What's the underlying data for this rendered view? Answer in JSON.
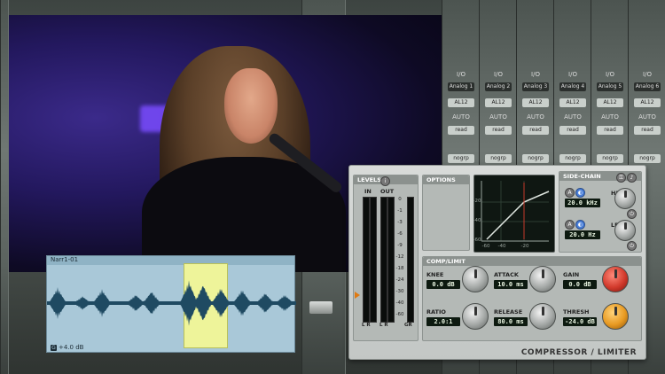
{
  "mixer": {
    "strips": [
      {
        "io": "I/O",
        "insert": "Analog 1",
        "bus": "AL12",
        "auto": "AUTO",
        "mode": "read",
        "group": "nogrp"
      },
      {
        "io": "I/O",
        "insert": "Analog 2",
        "bus": "AL12",
        "auto": "AUTO",
        "mode": "read",
        "group": "nogrp"
      },
      {
        "io": "I/O",
        "insert": "Analog 3",
        "bus": "AL12",
        "auto": "AUTO",
        "mode": "read",
        "group": "nogrp"
      },
      {
        "io": "I/O",
        "insert": "Analog 4",
        "bus": "AL12",
        "auto": "AUTO",
        "mode": "read",
        "group": "nogrp"
      },
      {
        "io": "I/O",
        "insert": "Analog 5",
        "bus": "AL12",
        "auto": "AUTO",
        "mode": "read",
        "group": "nogrp"
      },
      {
        "io": "I/O",
        "insert": "Analog 6",
        "bus": "AL12",
        "auto": "AUTO",
        "mode": "read",
        "group": "nogrp"
      }
    ]
  },
  "clip": {
    "name": "Narr1-01",
    "gain": "+4.0 dB",
    "gain_icon": "G"
  },
  "plugin": {
    "name": "COMPRESSOR / LIMITER",
    "levels": {
      "title": "LEVELS",
      "in_label": "IN",
      "out_label": "OUT",
      "lr_in": "L R",
      "lr_out": "L R",
      "gr_label": "GR",
      "scale": [
        "0",
        "-1",
        "-3",
        "-6",
        "-9",
        "-12",
        "-18",
        "-24",
        "-30",
        "-40",
        "-60"
      ]
    },
    "options": {
      "title": "OPTIONS"
    },
    "graph": {
      "y_ticks": [
        "-20",
        "-40",
        "-60"
      ],
      "x_ticks": [
        "-60",
        "-40",
        "-20"
      ]
    },
    "sidechain": {
      "title": "SIDE-CHAIN",
      "hf_label": "HF",
      "hf_value": "20.0 kHz",
      "lf_label": "LF",
      "lf_value": "20.0 Hz"
    },
    "complimit": {
      "title": "COMP/LIMIT",
      "knee_label": "KNEE",
      "knee_value": "0.0 dB",
      "attack_label": "ATTACK",
      "attack_value": "10.0 ms",
      "gain_label": "GAIN",
      "gain_value": "0.0 dB",
      "ratio_label": "RATIO",
      "ratio_value": "2.0:1",
      "release_label": "RELEASE",
      "release_value": "80.0 ms",
      "thresh_label": "THRESH",
      "thresh_value": "-24.0 dB"
    }
  }
}
